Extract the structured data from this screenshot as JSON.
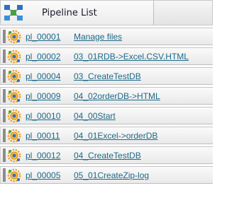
{
  "header": {
    "title": "Pipeline List",
    "icon": "pipeline-network-icon"
  },
  "row_icon": "gear-cluster-icon",
  "pipelines": [
    {
      "id": "pl_00001",
      "name": "Manage files"
    },
    {
      "id": "pl_00002",
      "name": "03_01RDB->Excel.CSV.HTML"
    },
    {
      "id": "pl_00004",
      "name": "03_CreateTestDB"
    },
    {
      "id": "pl_00009",
      "name": "04_02orderDB->HTML"
    },
    {
      "id": "pl_00010",
      "name": "04_00Start"
    },
    {
      "id": "pl_00011",
      "name": "04_01Excel->orderDB"
    },
    {
      "id": "pl_00012",
      "name": "04_CreateTestDB"
    },
    {
      "id": "pl_00005",
      "name": "05_01CreateZip-log"
    }
  ],
  "colors": {
    "link": "#1d6a88",
    "icon_blue": "#2f6fc4",
    "icon_orange": "#f0a020",
    "icon_green": "#4aa03a"
  }
}
